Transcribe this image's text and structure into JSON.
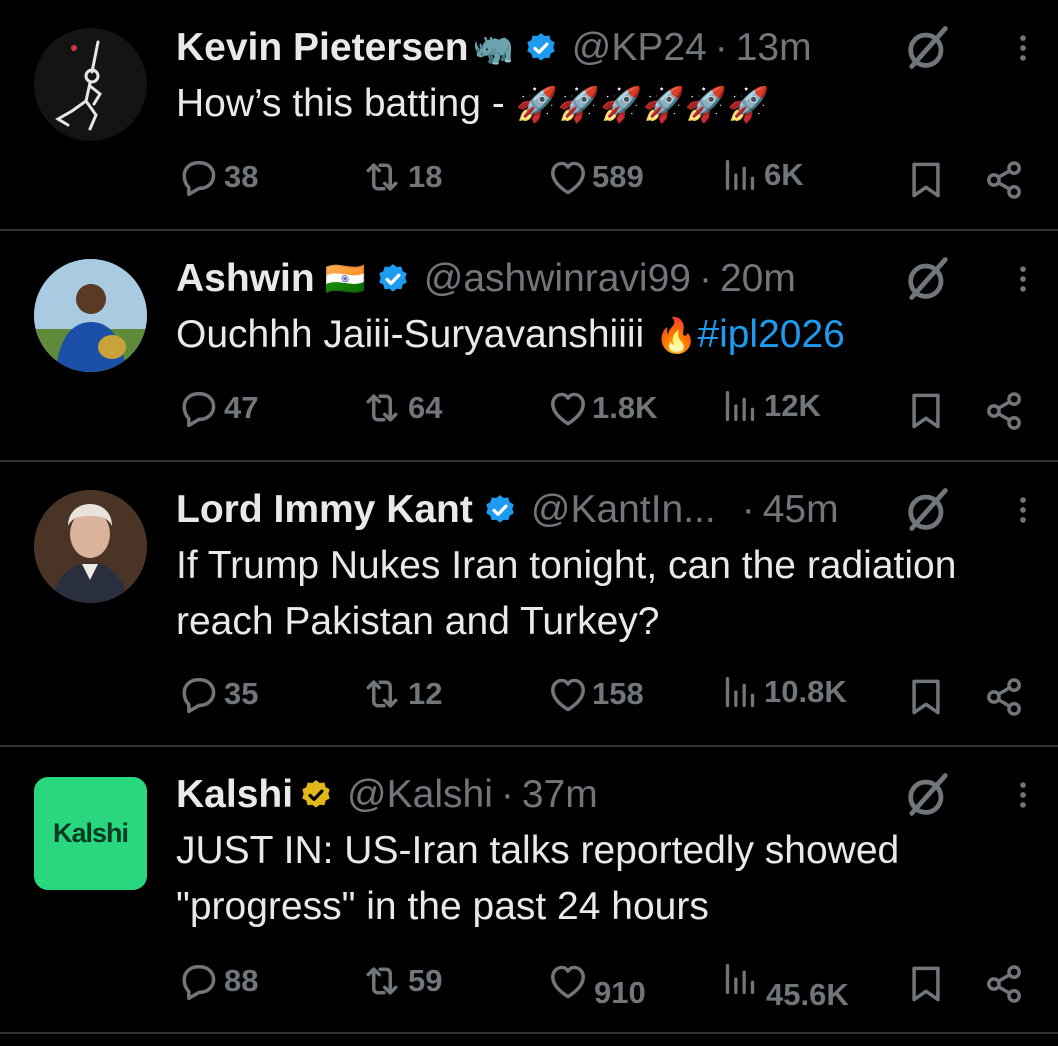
{
  "tweets": [
    {
      "name": "Kevin Pietersen",
      "name_emoji": "🦏",
      "badge": "blue",
      "handle": "@KP24",
      "time": "13m",
      "text": "How’s this batting - ",
      "text_emoji": "🚀🚀🚀🚀🚀🚀",
      "replies": "38",
      "reposts": "18",
      "likes": "589",
      "views": "6K"
    },
    {
      "name": "Ashwin",
      "name_emoji": "🇮🇳",
      "badge": "blue",
      "handle": "@ashwinravi99",
      "time": "20m",
      "text": "Ouchhh Jaiii-Suryavanshiiii ",
      "text_emoji": "🔥",
      "hashtag": "#ipl2026",
      "replies": "47",
      "reposts": "64",
      "likes": "1.8K",
      "views": "12K"
    },
    {
      "name": "Lord Immy Kant",
      "badge": "blue",
      "handle": "@KantIn...",
      "time": "45m",
      "text": "If Trump Nukes Iran tonight, can the radiation reach Pakistan and Turkey?",
      "replies": "35",
      "reposts": "12",
      "likes": "158",
      "views": "10.8K"
    },
    {
      "name": "Kalshi",
      "badge": "gold",
      "handle": "@Kalshi",
      "time": "37m",
      "avatar_text": "Kalshi",
      "text": "JUST IN: US-Iran talks reportedly showed \"progress\" in the past 24 hours",
      "replies": "88",
      "reposts": "59",
      "likes": "910",
      "views": "45.6K"
    }
  ],
  "colors": {
    "background": "#000000",
    "text": "#e7e9ea",
    "muted": "#71767b",
    "link": "#1d9bf0",
    "verified_blue": "#1d9bf0",
    "verified_gold": "#e2b719",
    "kalshi_green": "#28d77e",
    "divider": "#2f3336"
  },
  "icons": [
    "reply-icon",
    "repost-icon",
    "like-icon",
    "views-icon",
    "bookmark-icon",
    "share-icon",
    "grok-icon",
    "more-icon",
    "verified-badge-icon"
  ]
}
